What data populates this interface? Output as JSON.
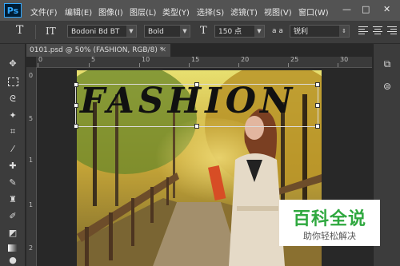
{
  "app": {
    "logo": "Ps"
  },
  "menu": [
    {
      "label": "文件(F)"
    },
    {
      "label": "编辑(E)"
    },
    {
      "label": "图像(I)"
    },
    {
      "label": "图层(L)"
    },
    {
      "label": "类型(Y)"
    },
    {
      "label": "选择(S)"
    },
    {
      "label": "滤镜(T)"
    },
    {
      "label": "视图(V)"
    },
    {
      "label": "窗口(W)"
    }
  ],
  "window_controls": {
    "minimize": "—",
    "maximize": "□",
    "close": "✕"
  },
  "options": {
    "tool_glyph": "T",
    "orient_glyph": "IT",
    "font_family": "Bodoni Bd BT",
    "font_style": "Bold",
    "size_glyph": "T",
    "font_size": "150 点",
    "aa_glyph": "a a",
    "antialias": "锐利"
  },
  "document": {
    "tab_title": "0101.psd @ 50% (FASHION, RGB/8) *",
    "close_glyph": "✕"
  },
  "ruler": {
    "top": [
      "0",
      "5",
      "10",
      "15",
      "20",
      "25",
      "30"
    ],
    "left": [
      "0",
      "5",
      "1",
      "1",
      "2"
    ]
  },
  "canvas": {
    "headline": "FASHION"
  },
  "watermark": {
    "title": "百科全说",
    "subtitle": "助你轻松解决"
  },
  "colors": {
    "accent": "#31a8ff",
    "watermark_green": "#2fa83f"
  }
}
